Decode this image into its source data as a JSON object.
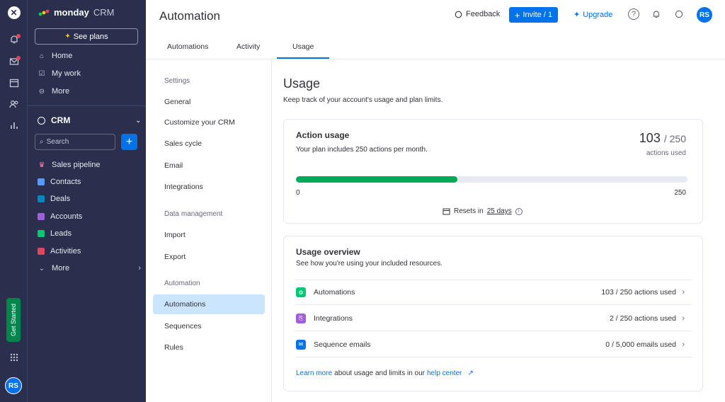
{
  "rail": {
    "get_started": "Get Started",
    "avatar": "RS"
  },
  "sidebar": {
    "brand_bold": "monday",
    "brand_light": "CRM",
    "see_plans": "See plans",
    "top_items": [
      {
        "label": "Home"
      },
      {
        "label": "My work"
      },
      {
        "label": "More"
      }
    ],
    "workspace": "CRM",
    "search_placeholder": "Search",
    "items": [
      {
        "label": "Sales pipeline",
        "color": "#e2445c"
      },
      {
        "label": "Contacts",
        "color": "#579bfc"
      },
      {
        "label": "Deals",
        "color": "#0086c0"
      },
      {
        "label": "Accounts",
        "color": "#a25ddc"
      },
      {
        "label": "Leads",
        "color": "#00c875"
      },
      {
        "label": "Activities",
        "color": "#e2445c"
      },
      {
        "label": "More"
      }
    ]
  },
  "header": {
    "title": "Automation",
    "feedback": "Feedback",
    "invite": "Invite / 1",
    "upgrade": "Upgrade",
    "avatar": "RS"
  },
  "tabs": [
    {
      "label": "Automations"
    },
    {
      "label": "Activity"
    },
    {
      "label": "Usage"
    }
  ],
  "settings_nav": {
    "sections": [
      {
        "heading": "Settings",
        "items": [
          "General",
          "Customize your CRM",
          "Sales cycle",
          "Email",
          "Integrations"
        ]
      },
      {
        "heading": "Data management",
        "items": [
          "Import",
          "Export"
        ]
      },
      {
        "heading": "Automation",
        "items": [
          "Automations",
          "Sequences",
          "Rules"
        ]
      }
    ],
    "active": "Automations"
  },
  "main": {
    "title": "Usage",
    "subtitle": "Keep track of your account's usage and plan limits.",
    "action_usage": {
      "title": "Action usage",
      "subtitle": "Your plan includes 250 actions per month.",
      "used": "103",
      "total": "/ 250",
      "used_label": "actions used",
      "progress": 0.412,
      "min": "0",
      "max": "250",
      "reset_prefix": "Resets in",
      "reset_days": "25 days"
    },
    "overview": {
      "title": "Usage overview",
      "subtitle": "See how you're using your included resources.",
      "rows": [
        {
          "label": "Automations",
          "value": "103 / 250 actions used",
          "color": "#00c875"
        },
        {
          "label": "Integrations",
          "value": "2 / 250 actions used",
          "color": "#a25ddc"
        },
        {
          "label": "Sequence emails",
          "value": "0 / 5,000 emails used",
          "color": "#0073ea"
        }
      ],
      "learn_more": "Learn more",
      "learn_text": "about usage and limits in our",
      "help_center": "help center"
    }
  }
}
